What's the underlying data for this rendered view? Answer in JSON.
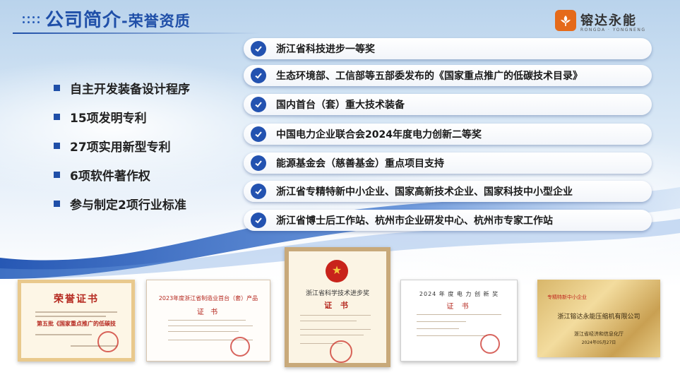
{
  "header": {
    "title": "公司简介",
    "subtitle": "-荣誉资质"
  },
  "logo": {
    "name": "镕达永能",
    "sub": "RONGDA · YONGNENG"
  },
  "capabilities": [
    "自主开发装备设计程序",
    "15项发明专利",
    "27项实用新型专利",
    "6项软件著作权",
    "参与制定2项行业标准"
  ],
  "honors": [
    "浙江省科技进步一等奖",
    "生态环境部、工信部等五部委发布的《国家重点推广的低碳技术目录》",
    "国内首台（套）重大技术装备",
    "中国电力企业联合会2024年度电力创新二等奖",
    "能源基金会（慈善基金）重点项目支持",
    "浙江省专精特新中小企业、国家高新技术企业、国家科技中小型企业",
    "浙江省博士后工作站、杭州市企业研发中心、杭州市专家工作站"
  ],
  "certificates": {
    "c1": {
      "title": "荣誉证书",
      "banner": "第五批《国家重点推广的低碳技术目录》"
    },
    "c2": {
      "title": "2023年度浙江省制造业首台（套）产品",
      "sub": "证 书"
    },
    "c3": {
      "title": "浙江省科学技术进步奖",
      "sub": "证 书"
    },
    "c4": {
      "title": "2024 年 度 电 力 创 新 奖",
      "sub": "证 书"
    },
    "c5": {
      "top": "专精特新中小企业",
      "main": "浙江镕达永能压缩机有限公司",
      "org": "浙江省经济和信息化厅",
      "date": "2024年05月27日"
    }
  },
  "colors": {
    "accent": "#1f4fa8",
    "check": "#2352b0",
    "brand": "#e56a1a"
  }
}
